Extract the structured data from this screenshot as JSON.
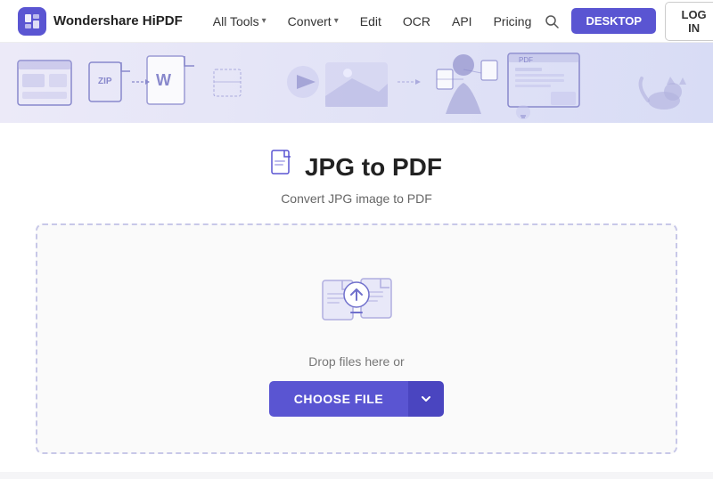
{
  "navbar": {
    "brand": "Wondershare HiPDF",
    "logo_label": "HiPDF logo",
    "items": [
      {
        "label": "All Tools",
        "has_dropdown": true
      },
      {
        "label": "Convert",
        "has_dropdown": true
      },
      {
        "label": "Edit",
        "has_dropdown": false
      },
      {
        "label": "OCR",
        "has_dropdown": false
      },
      {
        "label": "API",
        "has_dropdown": false
      },
      {
        "label": "Pricing",
        "has_dropdown": false
      }
    ],
    "desktop_btn": "DESKTOP",
    "login_btn": "LOG IN"
  },
  "page": {
    "title": "JPG to PDF",
    "subtitle": "Convert JPG image to PDF"
  },
  "dropzone": {
    "drop_text": "Drop files here or",
    "choose_file_btn": "CHOOSE FILE"
  },
  "colors": {
    "primary": "#5a55d2",
    "primary_dark": "#4a45c0"
  }
}
